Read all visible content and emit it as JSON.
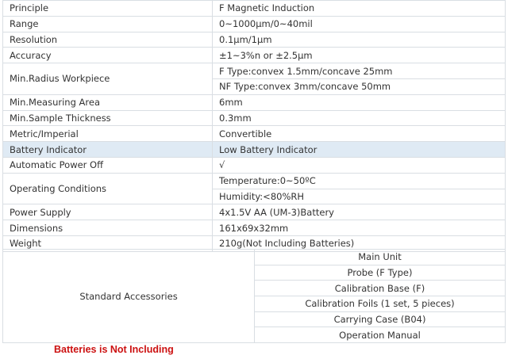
{
  "specs": [
    {
      "label": "Principle",
      "values": [
        "F Magnetic Induction"
      ]
    },
    {
      "label": "Range",
      "values": [
        "0~1000μm/0~40mil"
      ]
    },
    {
      "label": "Resolution",
      "values": [
        "0.1μm/1μm"
      ]
    },
    {
      "label": "Accuracy",
      "values": [
        "±1~3%n or ±2.5μm"
      ]
    },
    {
      "label": "Min.Radius Workpiece",
      "values": [
        "F Type:convex 1.5mm/concave 25mm",
        "NF Type:convex 3mm/concave 50mm"
      ]
    },
    {
      "label": "Min.Measuring Area",
      "values": [
        "6mm"
      ]
    },
    {
      "label": "Min.Sample Thickness",
      "values": [
        "0.3mm"
      ]
    },
    {
      "label": "Metric/Imperial",
      "values": [
        "Convertible"
      ]
    },
    {
      "label": "Battery Indicator",
      "values": [
        "Low Battery Indicator"
      ]
    },
    {
      "label": "Automatic Power Off",
      "values": [
        "√"
      ]
    },
    {
      "label": "Operating Conditions",
      "values": [
        "Temperature:0~50ºC",
        "Humidity:<80%RH"
      ]
    },
    {
      "label": "Power Supply",
      "values": [
        "4x1.5V AA (UM-3)Battery"
      ]
    },
    {
      "label": "Dimensions",
      "values": [
        "161x69x32mm"
      ]
    },
    {
      "label": "Weight",
      "values": [
        "210g(Not Including Batteries)"
      ]
    }
  ],
  "accessories": {
    "label": "Standard Accessories",
    "items": [
      "Main Unit",
      "Probe (F Type)",
      "Calibration Base (F)",
      "Calibration Foils (1 set, 5 pieces)",
      "Carrying Case (B04)",
      "Operation Manual"
    ]
  },
  "footer_note": "Batteries is Not Including",
  "colors": {
    "highlight_row": "#dfeaf4",
    "border": "#d9dee3",
    "note": "#cc1111"
  }
}
